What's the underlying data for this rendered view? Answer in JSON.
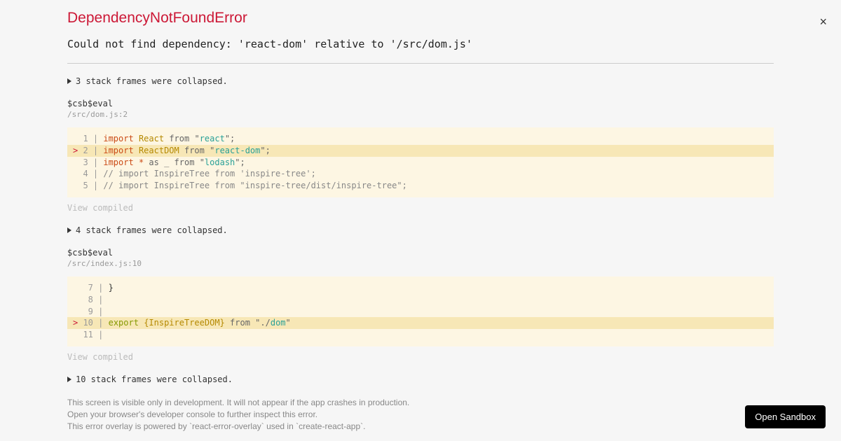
{
  "header": {
    "title": "DependencyNotFoundError",
    "close_label": "×"
  },
  "message": "Could not find dependency: 'react-dom' relative to '/src/dom.js'",
  "frames": [
    {
      "collapse_text": "3 stack frames were collapsed.",
      "label": "$csb$eval",
      "location": "/src/dom.js:2",
      "lines": [
        {
          "gutter": "  1 | ",
          "hl": false,
          "tokens": [
            [
              "kw-import",
              "import"
            ],
            [
              "plain",
              " "
            ],
            [
              "ident",
              "React"
            ],
            [
              "plain",
              " "
            ],
            [
              "from",
              "from"
            ],
            [
              "plain",
              " "
            ],
            [
              "quote",
              "\""
            ],
            [
              "str",
              "react"
            ],
            [
              "quote",
              "\""
            ],
            [
              "semi",
              ";"
            ]
          ]
        },
        {
          "gutter": "> 2 | ",
          "hl": true,
          "tokens": [
            [
              "kw-import",
              "import"
            ],
            [
              "plain",
              " "
            ],
            [
              "ident",
              "ReactDOM"
            ],
            [
              "plain",
              " "
            ],
            [
              "from",
              "from"
            ],
            [
              "plain",
              " "
            ],
            [
              "quote",
              "\""
            ],
            [
              "str",
              "react-dom"
            ],
            [
              "quote",
              "\""
            ],
            [
              "semi",
              ";"
            ]
          ]
        },
        {
          "gutter": "  3 | ",
          "hl": false,
          "tokens": [
            [
              "kw-import",
              "import"
            ],
            [
              "plain",
              " "
            ],
            [
              "star",
              "*"
            ],
            [
              "plain",
              " "
            ],
            [
              "from",
              "as _ from"
            ],
            [
              "plain",
              " "
            ],
            [
              "quote",
              "\""
            ],
            [
              "str",
              "lodash"
            ],
            [
              "quote",
              "\""
            ],
            [
              "semi",
              ";"
            ]
          ]
        },
        {
          "gutter": "  4 | ",
          "hl": false,
          "tokens": [
            [
              "comment",
              "// import InspireTree from 'inspire-tree';"
            ]
          ]
        },
        {
          "gutter": "  5 | ",
          "hl": false,
          "tokens": [
            [
              "comment",
              "// import InspireTree from \"inspire-tree/dist/inspire-tree\";"
            ]
          ]
        }
      ],
      "view_compiled": "View compiled"
    },
    {
      "collapse_text": "4 stack frames were collapsed.",
      "label": "$csb$eval",
      "location": "/src/index.js:10",
      "lines": [
        {
          "gutter": "   7 | ",
          "hl": false,
          "tokens": [
            [
              "plain",
              "}"
            ]
          ]
        },
        {
          "gutter": "   8 | ",
          "hl": false,
          "tokens": []
        },
        {
          "gutter": "   9 | ",
          "hl": false,
          "tokens": []
        },
        {
          "gutter": "> 10 | ",
          "hl": true,
          "tokens": [
            [
              "kw-export",
              "export"
            ],
            [
              "plain",
              " "
            ],
            [
              "ident",
              "{InspireTreeDOM}"
            ],
            [
              "plain",
              " "
            ],
            [
              "from",
              "from"
            ],
            [
              "plain",
              " "
            ],
            [
              "quote",
              "\""
            ],
            [
              "from",
              "./"
            ],
            [
              "str",
              "dom"
            ],
            [
              "quote",
              "\""
            ]
          ]
        },
        {
          "gutter": "  11 | ",
          "hl": false,
          "tokens": []
        }
      ],
      "view_compiled": "View compiled"
    }
  ],
  "final_collapse": "10 stack frames were collapsed.",
  "footer": {
    "line1": "This screen is visible only in development. It will not appear if the app crashes in production.",
    "line2": "Open your browser's developer console to further inspect this error.",
    "line3": "This error overlay is powered by `react-error-overlay` used in `create-react-app`."
  },
  "sandbox_button": "Open Sandbox"
}
